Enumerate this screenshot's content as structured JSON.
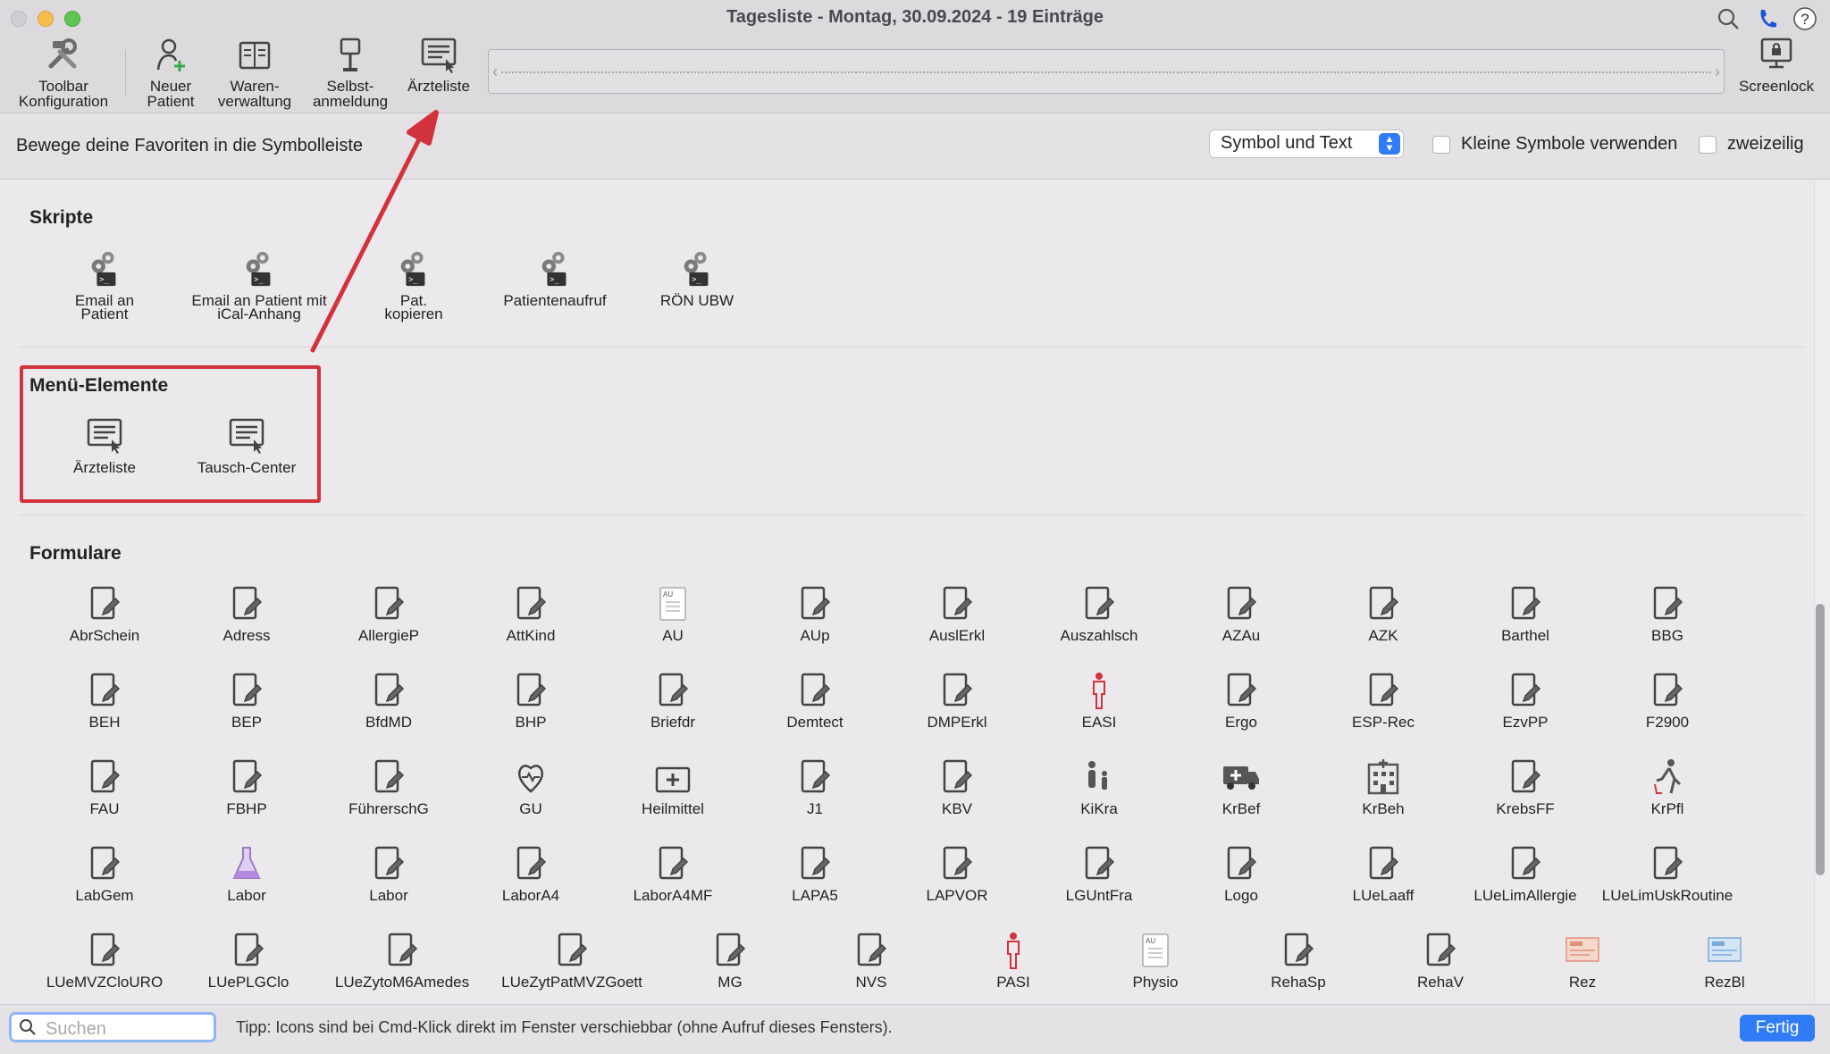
{
  "window": {
    "title": "Tagesliste - Montag, 30.09.2024 - 19 Einträge"
  },
  "toolbar": {
    "items": [
      {
        "label": "Toolbar\nKonfiguration",
        "icon": "tools-icon"
      },
      {
        "label": "Neuer\nPatient",
        "icon": "new-patient-icon"
      },
      {
        "label": "Waren-\nverwaltung",
        "icon": "inventory-icon"
      },
      {
        "label": "Selbst-\nanmeldung",
        "icon": "kiosk-icon"
      },
      {
        "label": "Ärzteliste",
        "icon": "doctor-list-icon"
      }
    ],
    "screenlock_label": "Screenlock"
  },
  "config": {
    "hint": "Bewege deine Favoriten in die Symbolleiste",
    "display_mode": "Symbol und Text",
    "small_icons_label": "Kleine Symbole verwenden",
    "small_icons_checked": false,
    "two_rows_label": "zweizeilig",
    "two_rows_checked": false
  },
  "sections": {
    "scripts": {
      "title": "Skripte",
      "items": [
        {
          "label": "Email an\nPatient"
        },
        {
          "label": "Email an Patient mit\niCal-Anhang"
        },
        {
          "label": "Pat.\nkopieren"
        },
        {
          "label": "Patientenaufruf"
        },
        {
          "label": "RÖN UBW"
        }
      ]
    },
    "menu": {
      "title": "Menü-Elemente",
      "items": [
        {
          "label": "Ärzteliste"
        },
        {
          "label": "Tausch-Center"
        }
      ]
    },
    "forms": {
      "title": "Formulare",
      "rows": [
        [
          "AbrSchein",
          "Adress",
          "AllergieP",
          "AttKind",
          "AU",
          "AUp",
          "AuslErkl",
          "Auszahlsch",
          "AZAu",
          "AZK",
          "Barthel",
          "BBG"
        ],
        [
          "BEH",
          "BEP",
          "BfdMD",
          "BHP",
          "Briefdr",
          "Demtect",
          "DMPErkl",
          "EASI",
          "Ergo",
          "ESP-Rec",
          "EzvPP",
          "F2900"
        ],
        [
          "FAU",
          "FBHP",
          "FührerschG",
          "GU",
          "Heilmittel",
          "J1",
          "KBV",
          "KiKra",
          "KrBef",
          "KrBeh",
          "KrebsFF",
          "KrPfl"
        ],
        [
          "LabGem",
          "Labor",
          "Labor",
          "LaborA4",
          "LaborA4MF",
          "LAPA5",
          "LAPVOR",
          "LGUntFra",
          "Logo",
          "LUeLaaff",
          "LUeLimAllergie",
          "LUeLimUskRoutine"
        ],
        [
          "LUeMVZCloURO",
          "LUePLGClo",
          "LUeZytoM6Amedes",
          "LUeZytPatMVZGoett",
          "MG",
          "NVS",
          "PASI",
          "Physio",
          "RehaSp",
          "RehaV",
          "Rez",
          "RezBl"
        ]
      ]
    }
  },
  "bottom": {
    "search_placeholder": "Suchen",
    "tip": "Tipp: Icons sind bei Cmd-Klick direkt im Fenster verschiebbar (ohne Aufruf dieses Fensters).",
    "done_label": "Fertig"
  },
  "colors": {
    "accent": "#2f7cf6",
    "highlight": "#d2323b"
  }
}
